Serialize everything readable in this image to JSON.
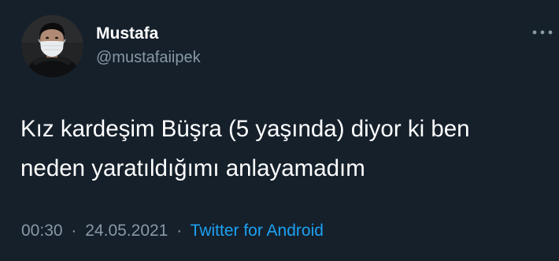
{
  "tweet": {
    "author": {
      "display_name": "Mustafa",
      "handle": "@mustafaiipek"
    },
    "text": "Kız kardeşim Büşra (5 yaşında) diyor ki ben\nneden yaratıldığımı anlayamadım",
    "time": "00:30",
    "separator": "·",
    "date": "24.05.2021",
    "source": "Twitter for Android",
    "more_icon": "more-horizontal-icon"
  },
  "colors": {
    "background": "#15202b",
    "text_primary": "#ffffff",
    "text_secondary": "#8899a6",
    "link": "#1da1f2"
  }
}
